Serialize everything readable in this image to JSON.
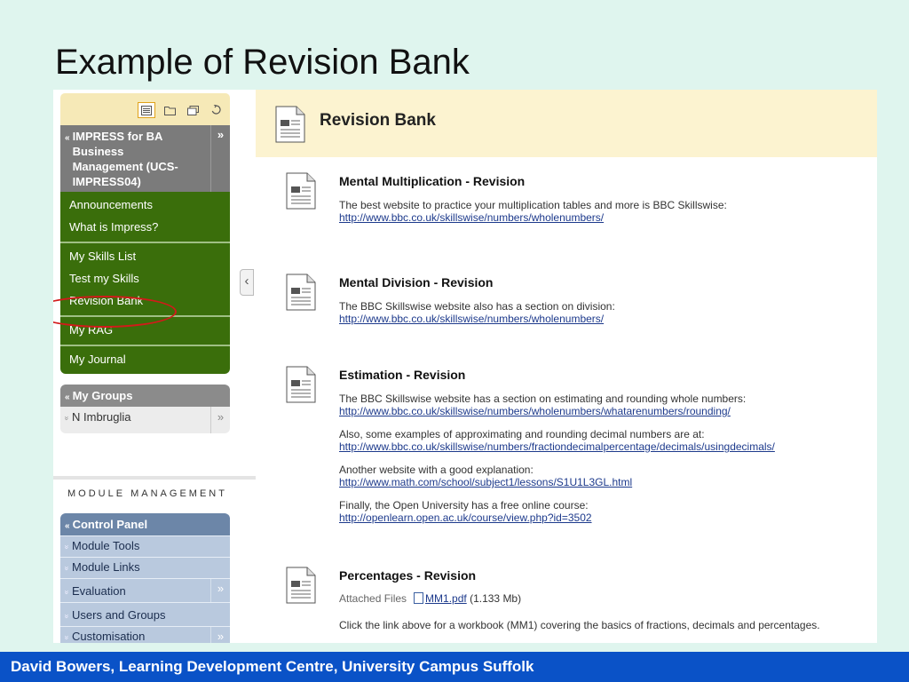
{
  "slide": {
    "title": "Example of Revision Bank",
    "footer": "David Bowers, Learning Development Centre, University Campus Suffolk"
  },
  "menu": {
    "course_title": "IMPRESS for BA Business Management (UCS-IMPRESS04)",
    "course_caret": "«",
    "course_chevron": "»",
    "groups": [
      [
        "Announcements",
        "What is Impress?"
      ],
      [
        "My Skills List",
        "Test my Skills",
        "Revision Bank"
      ],
      [
        "My RAG"
      ],
      [
        "My Journal"
      ]
    ],
    "my_groups": {
      "title": "My Groups",
      "caret": "«",
      "item": "N Imbruglia",
      "item_caret": "»",
      "chevron": "»"
    },
    "module_management_label": "MODULE MANAGEMENT",
    "control_panel": {
      "title": "Control Panel",
      "caret": "«",
      "items": [
        {
          "label": "Module Tools",
          "chevron": ""
        },
        {
          "label": "Module Links",
          "chevron": ""
        },
        {
          "label": "Evaluation",
          "chevron": "»"
        },
        {
          "label": "Users and Groups",
          "chevron": ""
        },
        {
          "label": "Customisation",
          "chevron": "»"
        }
      ],
      "item_caret": "»"
    },
    "collapse_glyph": "‹",
    "highlight_color": "#d21a1a"
  },
  "content": {
    "title": "Revision Bank",
    "items": [
      {
        "title": "Mental Multiplication - Revision",
        "paragraphs": [
          {
            "text": "The best website to practice your multiplication tables and more is BBC Skillswise:",
            "link": "http://www.bbc.co.uk/skillswise/numbers/wholenumbers/"
          }
        ]
      },
      {
        "title": "Mental Division - Revision",
        "paragraphs": [
          {
            "text": "The BBC Skillswise website also has a section on division:",
            "link": "http://www.bbc.co.uk/skillswise/numbers/wholenumbers/"
          }
        ]
      },
      {
        "title": "Estimation - Revision",
        "paragraphs": [
          {
            "text": "The BBC Skillswise website has a section on estimating and rounding whole numbers:",
            "link": "http://www.bbc.co.uk/skillswise/numbers/wholenumbers/whatarenumbers/rounding/"
          },
          {
            "text": "Also, some examples of approximating and rounding decimal numbers are at:",
            "link": "http://www.bbc.co.uk/skillswise/numbers/fractiondecimalpercentage/decimals/usingdecimals/"
          },
          {
            "text": "Another website with a good explanation:",
            "link": "http://www.math.com/school/subject1/lessons/S1U1L3GL.html"
          },
          {
            "text": "Finally, the Open University has a free online course:",
            "link": "http://openlearn.open.ac.uk/course/view.php?id=3502"
          }
        ]
      },
      {
        "title": "Percentages - Revision",
        "attached_label": "Attached Files",
        "attached_file": "MM1.pdf",
        "attached_size": "(1.133 Mb)",
        "description": "Click the link above for a workbook (MM1) covering the basics of fractions, decimals and percentages."
      }
    ]
  },
  "colors": {
    "slide_bg": "#dff5ee",
    "menu_green": "#3a6e0b",
    "control_panel_blue": "#6c86a8",
    "footer_blue": "#0a52c7",
    "header_cream": "#fcf3d0"
  }
}
